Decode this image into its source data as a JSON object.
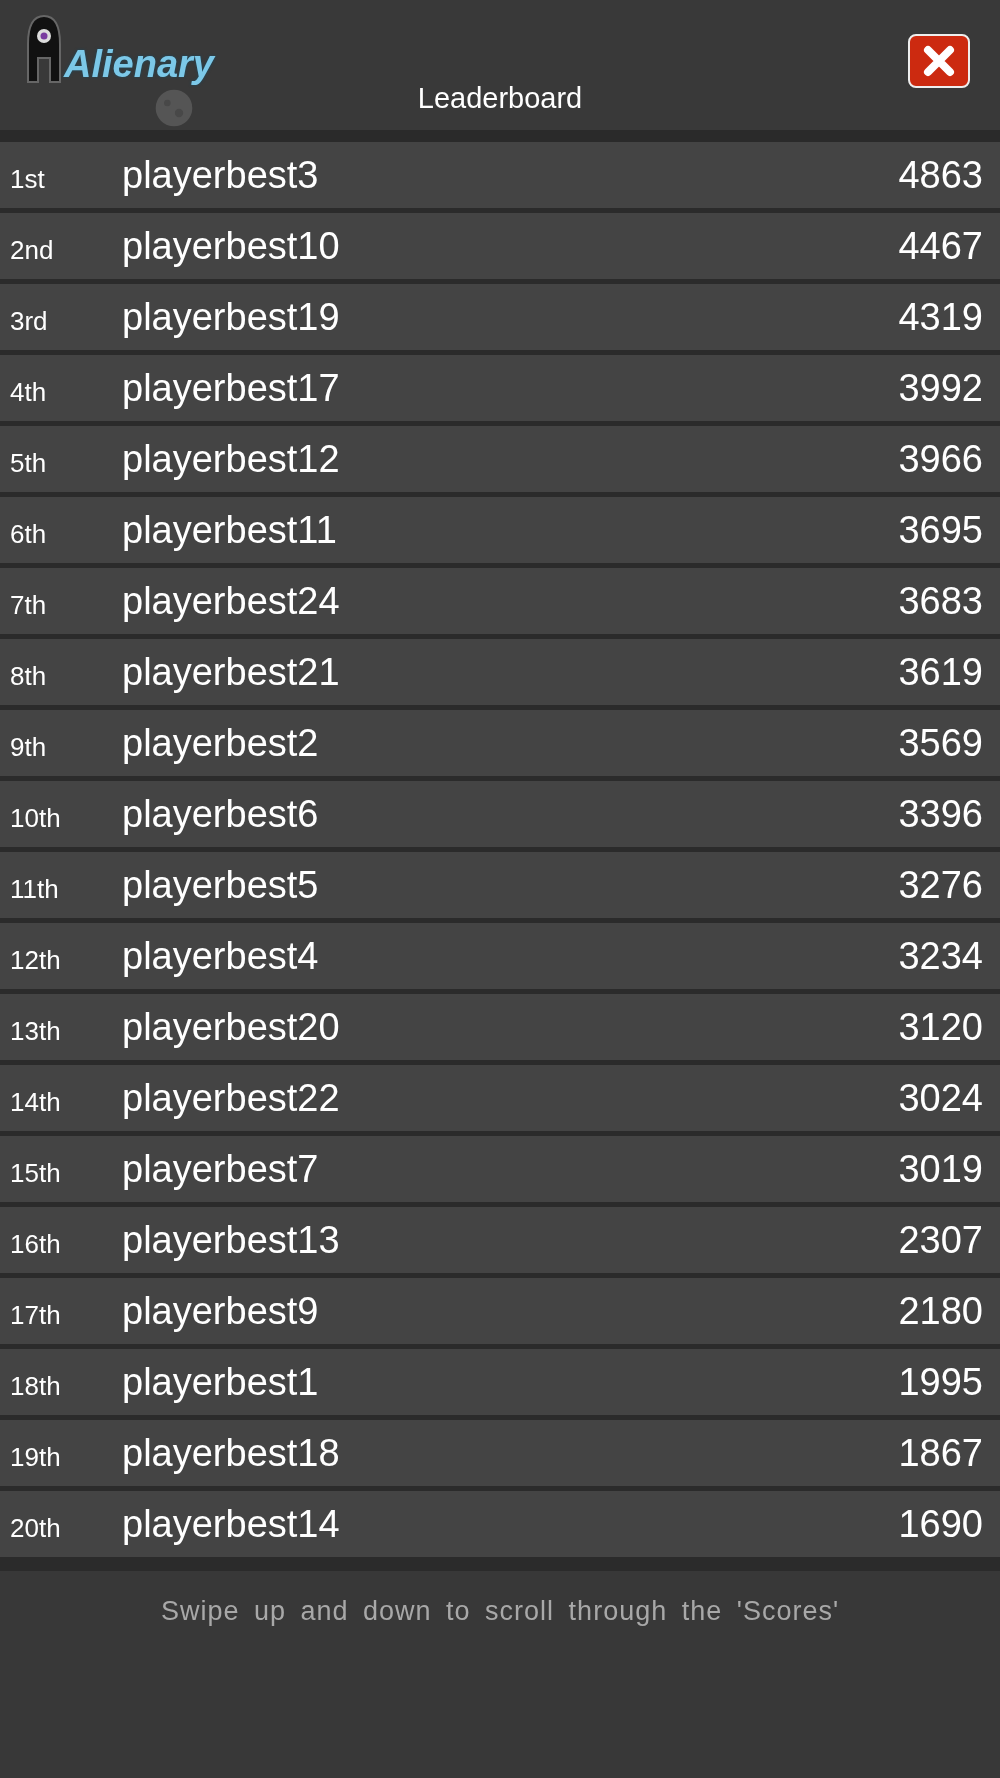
{
  "logo": "Alienary",
  "title": "Leaderboard",
  "rows": [
    {
      "rank": "1st",
      "name": "playerbest3",
      "score": "4863"
    },
    {
      "rank": "2nd",
      "name": "playerbest10",
      "score": "4467"
    },
    {
      "rank": "3rd",
      "name": "playerbest19",
      "score": "4319"
    },
    {
      "rank": "4th",
      "name": "playerbest17",
      "score": "3992"
    },
    {
      "rank": "5th",
      "name": "playerbest12",
      "score": "3966"
    },
    {
      "rank": "6th",
      "name": "playerbest11",
      "score": "3695"
    },
    {
      "rank": "7th",
      "name": "playerbest24",
      "score": "3683"
    },
    {
      "rank": "8th",
      "name": "playerbest21",
      "score": "3619"
    },
    {
      "rank": "9th",
      "name": "playerbest2",
      "score": "3569"
    },
    {
      "rank": "10th",
      "name": "playerbest6",
      "score": "3396"
    },
    {
      "rank": "11th",
      "name": "playerbest5",
      "score": "3276"
    },
    {
      "rank": "12th",
      "name": "playerbest4",
      "score": "3234"
    },
    {
      "rank": "13th",
      "name": "playerbest20",
      "score": "3120"
    },
    {
      "rank": "14th",
      "name": "playerbest22",
      "score": "3024"
    },
    {
      "rank": "15th",
      "name": "playerbest7",
      "score": "3019"
    },
    {
      "rank": "16th",
      "name": "playerbest13",
      "score": "2307"
    },
    {
      "rank": "17th",
      "name": "playerbest9",
      "score": "2180"
    },
    {
      "rank": "18th",
      "name": "playerbest1",
      "score": "1995"
    },
    {
      "rank": "19th",
      "name": "playerbest18",
      "score": "1867"
    },
    {
      "rank": "20th",
      "name": "playerbest14",
      "score": "1690"
    }
  ],
  "hint": "Swipe up and down to scroll through the 'Scores'"
}
